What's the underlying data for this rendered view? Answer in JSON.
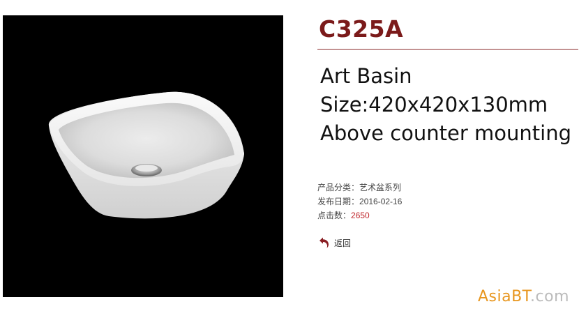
{
  "product": {
    "code": "C325A",
    "image_alt": "Art Basin",
    "description": [
      "Art Basin",
      "Size:420x420x130mm",
      "Above counter mounting"
    ],
    "meta": {
      "category_label": "产品分类：",
      "category_value": "艺术盆系列",
      "date_label": "发布日期：",
      "date_value": "2016-02-16",
      "clicks_label": "点击数：",
      "clicks_value": "2650"
    },
    "back_label": "返回"
  },
  "watermark": {
    "brand": "AsiaBT",
    "suffix": ".com"
  },
  "colors": {
    "title": "#7b1a1a",
    "rule": "#8a2a2a",
    "clicks": "#c0282d",
    "watermark_brand": "#e8961e",
    "watermark_suffix": "#bbbbbb"
  },
  "icons": {
    "back": "return-arrow-icon"
  }
}
